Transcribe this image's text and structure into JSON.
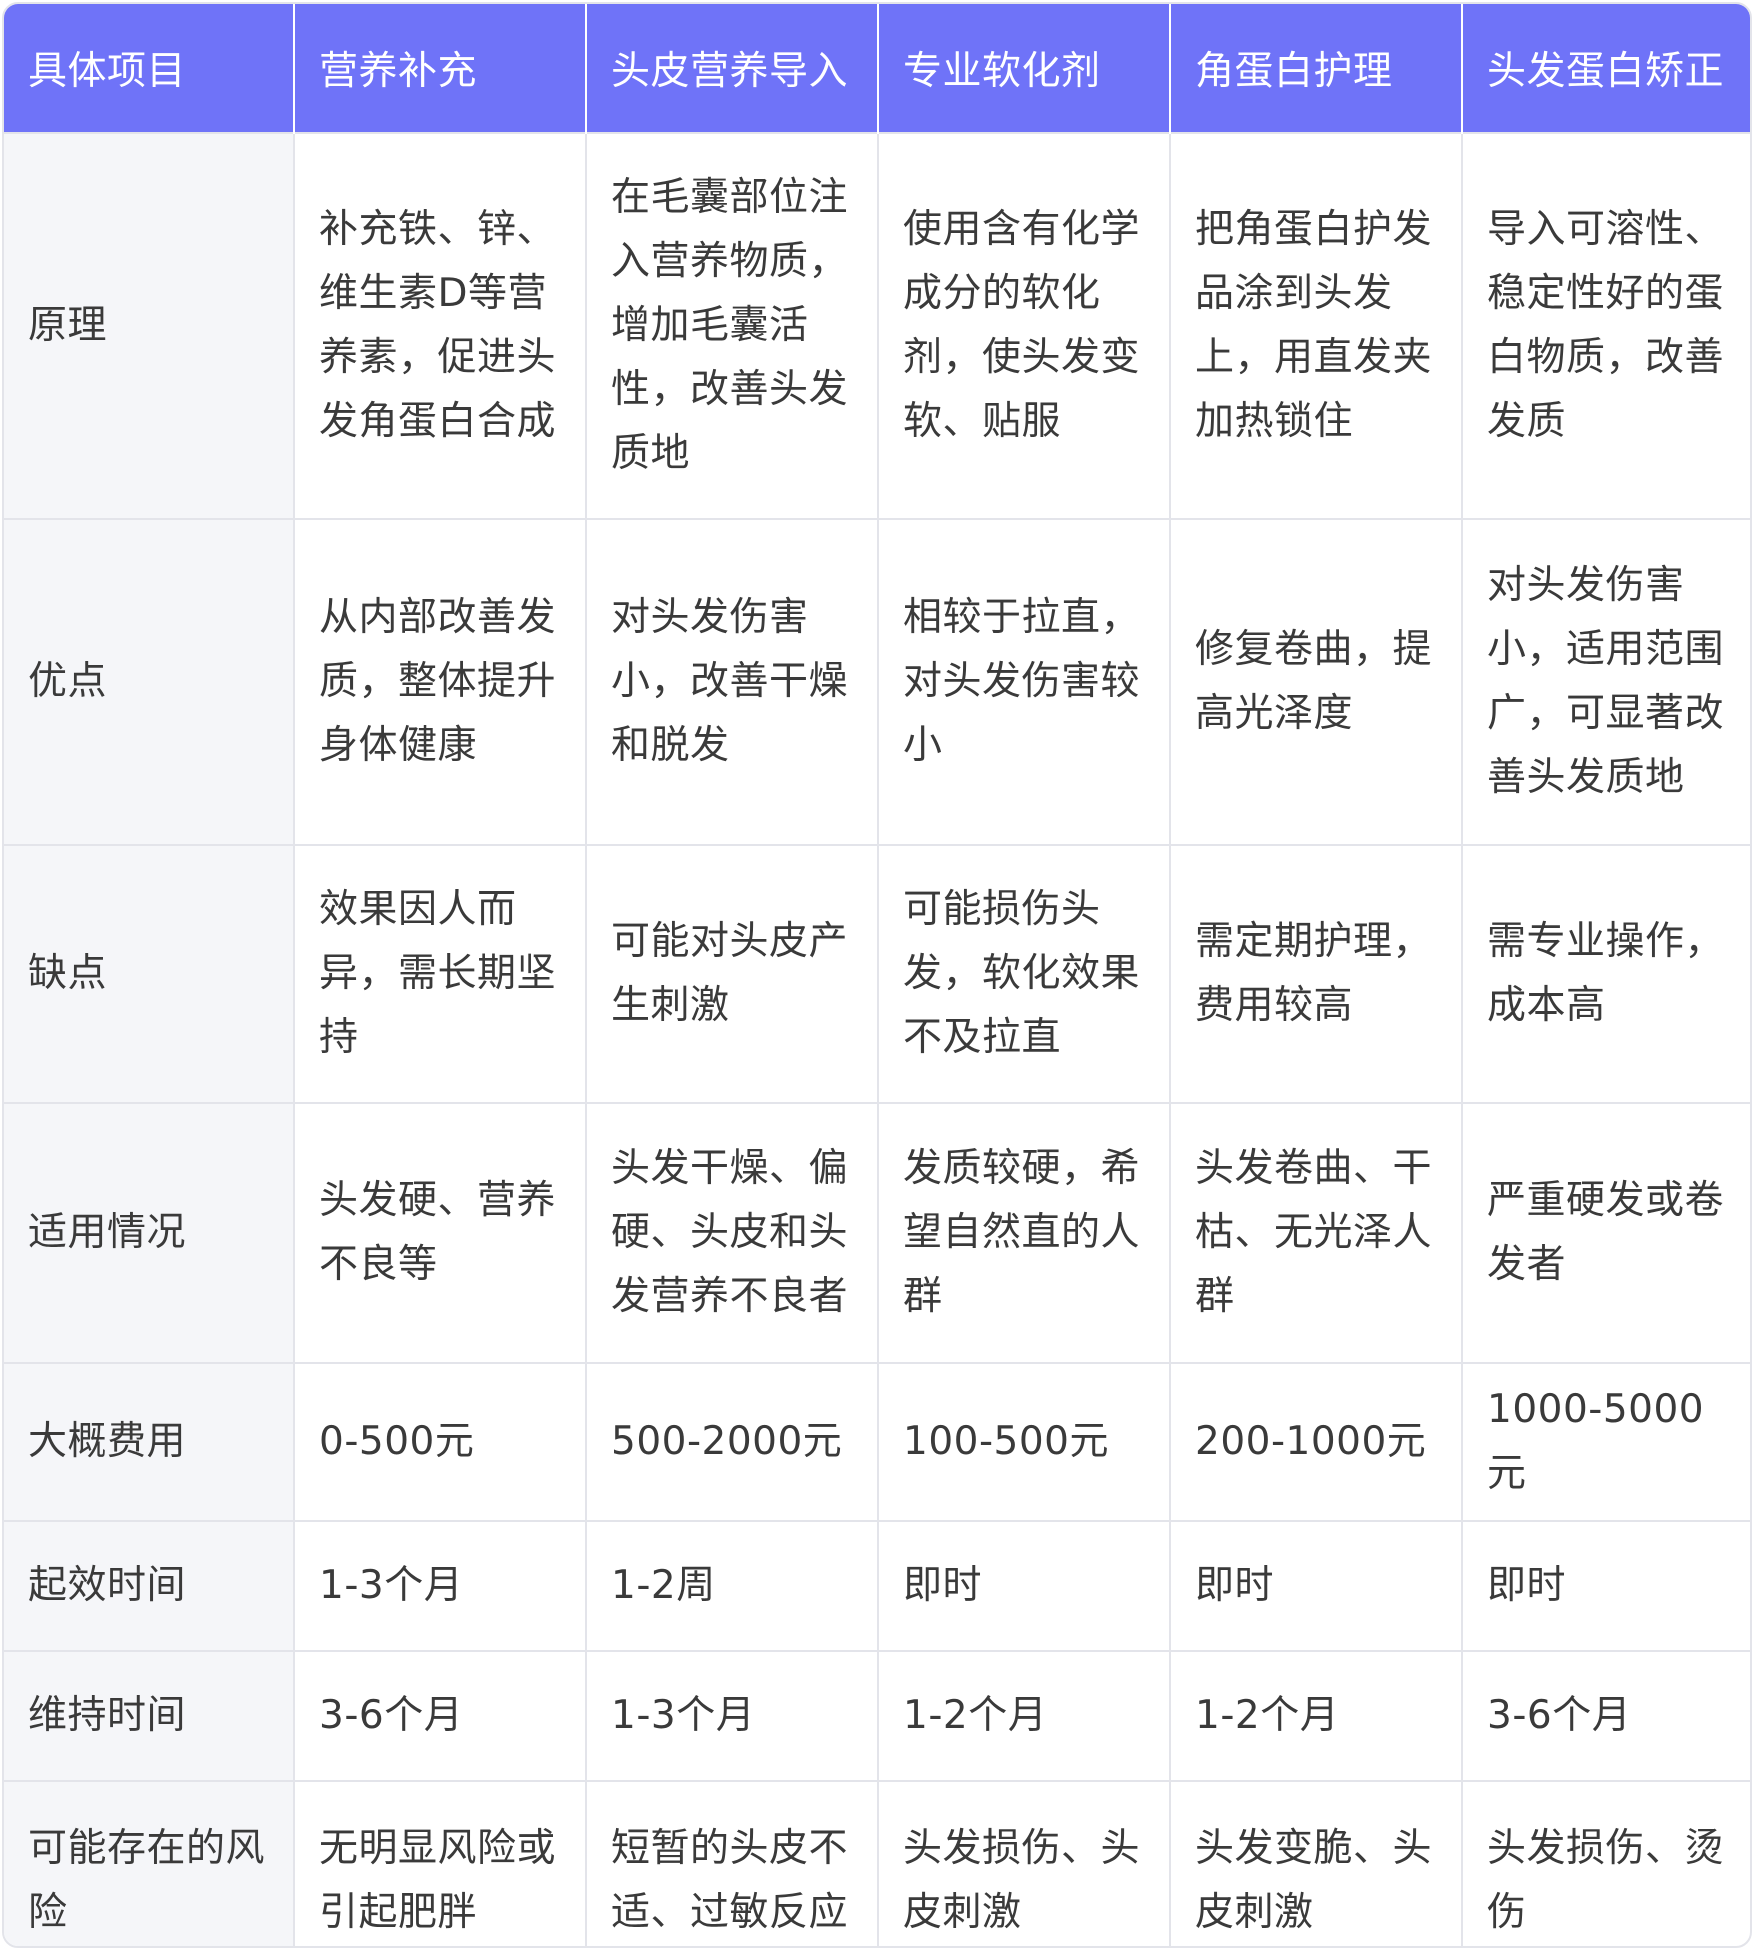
{
  "header": [
    "具体项目",
    "营养补充",
    "头皮营养导入",
    "专业软化剂",
    "角蛋白护理",
    "头发蛋白矫正"
  ],
  "rows": [
    {
      "key": "r-principle",
      "label": "原理",
      "cells": [
        "补充铁、锌、维生素D等营养素，促进头发角蛋白合成",
        "在毛囊部位注入营养物质，增加毛囊活性，改善头发质地",
        "使用含有化学成分的软化剂，使头发变软、贴服",
        "把角蛋白护发品涂到头发上，用直发夹加热锁住",
        "导入可溶性、稳定性好的蛋白物质，改善发质"
      ]
    },
    {
      "key": "r-pros",
      "label": "优点",
      "cells": [
        "从内部改善发质，整体提升身体健康",
        "对头发伤害小，改善干燥和脱发",
        "相较于拉直，对头发伤害较小",
        "修复卷曲，提高光泽度",
        "对头发伤害小，适用范围广，可显著改善头发质地"
      ]
    },
    {
      "key": "r-cons",
      "label": "缺点",
      "cells": [
        "效果因人而异，需长期坚持",
        "可能对头皮产生刺激",
        "可能损伤头发，软化效果不及拉直",
        "需定期护理，费用较高",
        "需专业操作，成本高"
      ]
    },
    {
      "key": "r-use",
      "label": "适用情况",
      "cells": [
        "头发硬、营养不良等",
        "头发干燥、偏硬、头皮和头发营养不良者",
        "发质较硬，希望自然直的人群",
        "头发卷曲、干枯、无光泽人群",
        "严重硬发或卷发者"
      ]
    },
    {
      "key": "r-cost",
      "label": "大概费用",
      "cells": [
        "0-500元",
        "500-2000元",
        "100-500元",
        "200-1000元",
        "1000-5000元"
      ]
    },
    {
      "key": "r-onset",
      "label": "起效时间",
      "cells": [
        "1-3个月",
        "1-2周",
        "即时",
        "即时",
        "即时"
      ]
    },
    {
      "key": "r-keep",
      "label": "维持时间",
      "cells": [
        "3-6个月",
        "1-3个月",
        "1-2个月",
        "1-2个月",
        "3-6个月"
      ]
    },
    {
      "key": "r-risk",
      "label": "可能存在的风险",
      "cells": [
        "无明显风险或引起肥胖",
        "短暂的头皮不适、过敏反应",
        "头发损伤、头皮刺激",
        "头发变脆、头皮刺激",
        "头发损伤、烫伤"
      ]
    }
  ],
  "colors": {
    "header_bg": "#6f73f8",
    "header_text": "#ffffff",
    "first_col_bg": "#f5f6f9",
    "border": "#e3e4ea",
    "body_text": "#3a3a3a"
  }
}
